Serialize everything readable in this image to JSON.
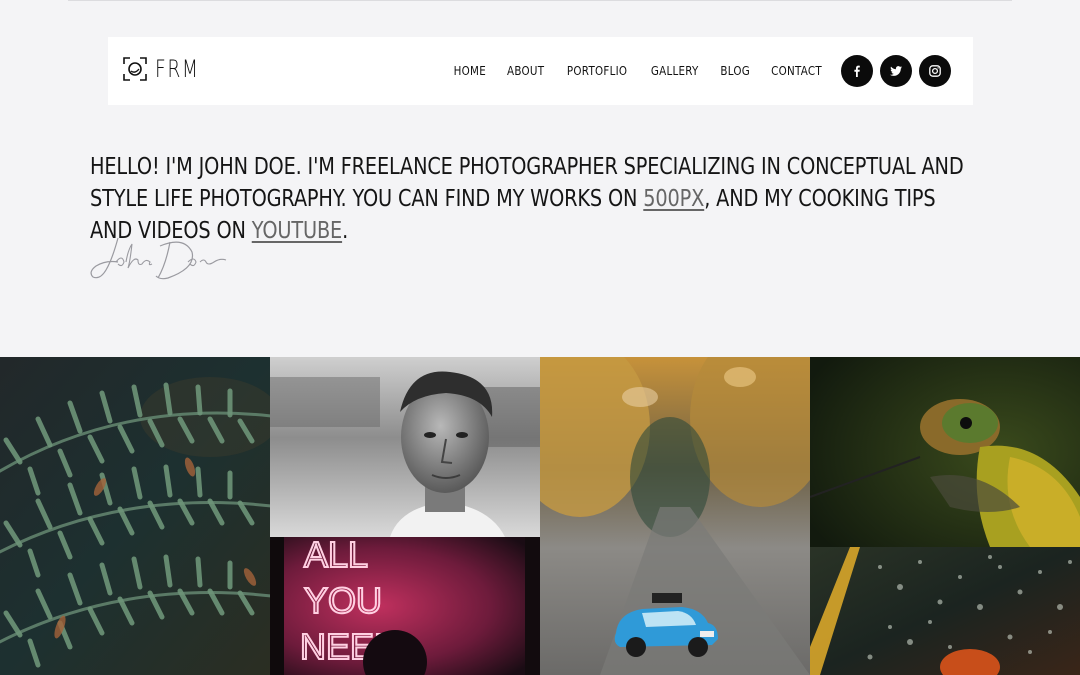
{
  "brand": {
    "logo_text": "FRM"
  },
  "nav": {
    "items": [
      {
        "label": "HOME"
      },
      {
        "label": "ABOUT"
      },
      {
        "label": "PORTOFLIO"
      },
      {
        "label": "GALLERY"
      },
      {
        "label": "BLOG"
      },
      {
        "label": "CONTACT"
      }
    ],
    "socials": [
      "facebook-icon",
      "twitter-icon",
      "instagram-icon"
    ]
  },
  "intro": {
    "text_before": "HELLO! I'M JOHN DOE. I'M FREELANCE PHOTOGRAPHER SPECIALIZING IN CONCEPTUAL AND STYLE LIFE PHOTOGRAPHY. YOU CAN FIND MY WORKS ON ",
    "link1": "500PX",
    "text_middle": ", AND MY COOKING TIPS AND VIDEOS ON ",
    "link2": "YOUTUBE",
    "text_after": "."
  },
  "signature": "John Doe",
  "gallery": {
    "items": [
      {
        "subject": "fern leaves"
      },
      {
        "subject": "portrait of a man"
      },
      {
        "subject": "neon sign",
        "sign_lines": [
          "ALL",
          "YOU",
          "NEED"
        ]
      },
      {
        "subject": "blurred street with toy car"
      },
      {
        "subject": "hummingbird"
      },
      {
        "subject": "raindrops on glass"
      }
    ]
  },
  "colors": {
    "background": "#f4f4f6",
    "navbar": "#ffffff",
    "text": "#151515",
    "link": "#666666",
    "social_bg": "#0b0b0b"
  }
}
